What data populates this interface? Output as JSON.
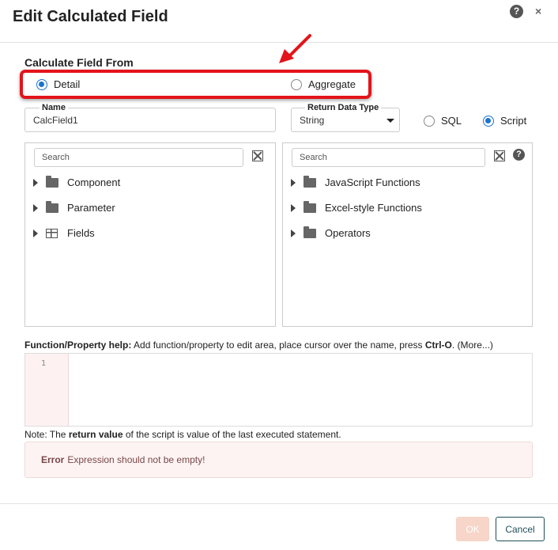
{
  "dialog": {
    "title": "Edit Calculated Field",
    "help_icon": "?",
    "close_icon": "×"
  },
  "calc_from": {
    "title": "Calculate Field From",
    "options": [
      {
        "label": "Detail",
        "checked": true
      },
      {
        "label": "Aggregate",
        "checked": false
      }
    ]
  },
  "name_field": {
    "label": "Name",
    "value": "CalcField1"
  },
  "return_type": {
    "label": "Return Data Type",
    "value": "String"
  },
  "lang": {
    "options": [
      {
        "label": "SQL",
        "checked": false
      },
      {
        "label": "Script",
        "checked": true
      }
    ]
  },
  "left_panel": {
    "search_placeholder": "Search",
    "items": [
      {
        "label": "Component",
        "icon": "folder-icon"
      },
      {
        "label": "Parameter",
        "icon": "folder-icon"
      },
      {
        "label": "Fields",
        "icon": "table-icon"
      }
    ]
  },
  "right_panel": {
    "search_placeholder": "Search",
    "help_icon": "?",
    "items": [
      {
        "label": "JavaScript Functions",
        "icon": "folder-icon"
      },
      {
        "label": "Excel-style Functions",
        "icon": "folder-icon"
      },
      {
        "label": "Operators",
        "icon": "folder-icon"
      }
    ]
  },
  "help_line": {
    "bold": "Function/Property help:",
    "text": " Add function/property to edit area, place cursor over the name, press ",
    "key": "Ctrl-O",
    "tail": ". ",
    "more": "(More...)"
  },
  "editor": {
    "line_number": "1"
  },
  "note": {
    "prefix": "Note: The ",
    "bold": "return value",
    "suffix": " of the script is value of the last executed statement."
  },
  "error": {
    "label": "Error",
    "message": "Expression should not be empty!"
  },
  "footer": {
    "ok_label": "OK",
    "cancel_label": "Cancel"
  },
  "colors": {
    "accent": "#1a73d1",
    "highlight": "#e3141a",
    "ok_disabled": "#f7d5c9",
    "cancel_border": "#1f4f56"
  }
}
